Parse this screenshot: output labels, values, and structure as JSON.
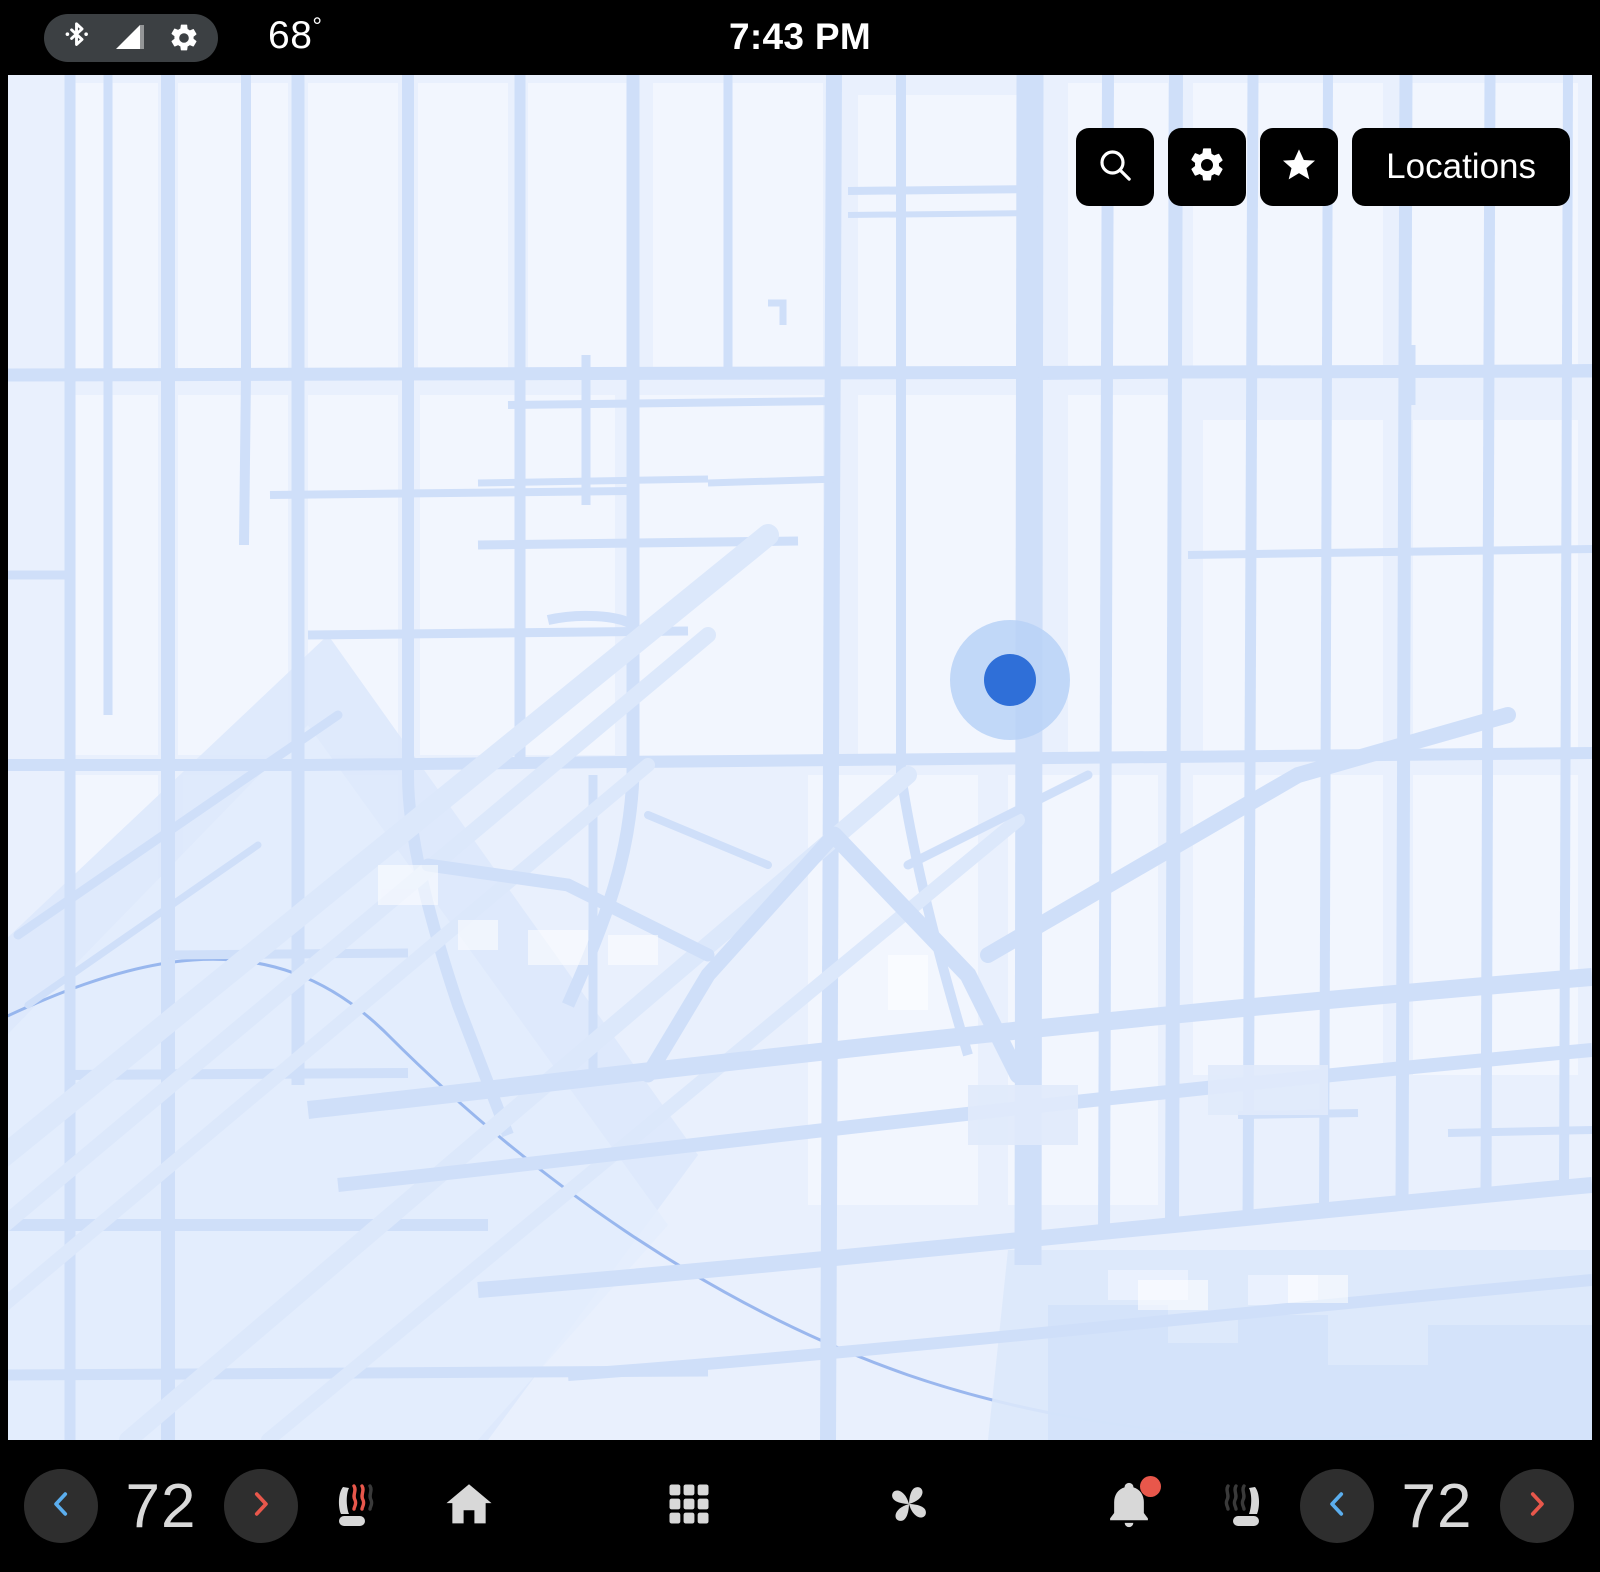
{
  "status_bar": {
    "bluetooth_icon": "bluetooth-icon",
    "signal_icon": "cell-signal-icon",
    "settings_icon": "gear-icon",
    "outside_temp": "68",
    "degree_symbol": "°",
    "clock": "7:43 PM"
  },
  "map": {
    "background_color": "#E9F0FD",
    "road_color": "#CFDFF9",
    "water_color": "#DCE8FB",
    "block_color": "#F2F6FE",
    "marker": {
      "name": "current-location-marker",
      "dot_color": "#2F6FD8",
      "halo_color": "#B9D2F7"
    },
    "toolbar": {
      "search_icon": "search-icon",
      "settings_icon": "gear-icon",
      "favorites_icon": "star-icon",
      "locations_label": "Locations"
    }
  },
  "bottom_bar": {
    "driver_climate": {
      "decrease_icon": "chevron-left-icon",
      "temperature": "72",
      "increase_icon": "chevron-right-icon",
      "seat_heater_icon": "heated-seat-icon",
      "seat_heater_active": true,
      "decrease_color": "#5BAEEE",
      "increase_color": "#E8574B"
    },
    "passenger_climate": {
      "seat_heater_icon": "heated-seat-icon",
      "seat_heater_active": false,
      "decrease_icon": "chevron-left-icon",
      "temperature": "72",
      "increase_icon": "chevron-right-icon",
      "decrease_color": "#5BAEEE",
      "increase_color": "#E8574B"
    },
    "nav": [
      {
        "name": "home-button",
        "icon": "home-icon"
      },
      {
        "name": "apps-button",
        "icon": "grid-apps-icon"
      },
      {
        "name": "climate-button",
        "icon": "fan-icon"
      },
      {
        "name": "notifications-button",
        "icon": "bell-icon",
        "badge": true,
        "badge_color": "#E8574B"
      }
    ]
  }
}
